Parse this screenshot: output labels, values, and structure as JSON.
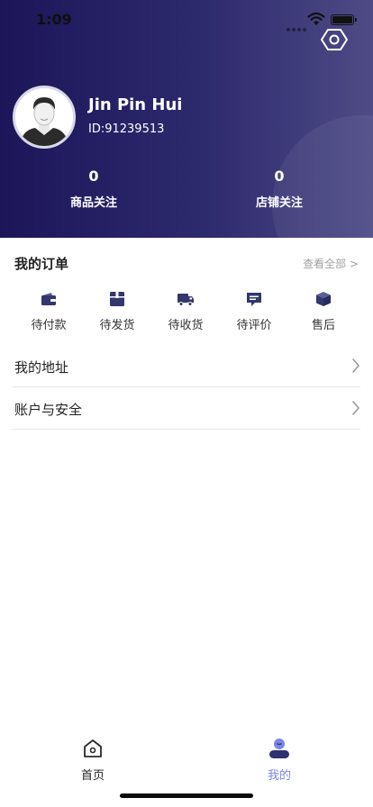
{
  "status_bar": {
    "time": "1:09"
  },
  "profile": {
    "name": "Jin Pin Hui",
    "id": "ID:91239513",
    "stats": [
      {
        "count": "0",
        "label": "商品关注"
      },
      {
        "count": "0",
        "label": "店铺关注"
      }
    ]
  },
  "orders": {
    "title": "我的订单",
    "view_all": "查看全部 >",
    "items": [
      {
        "label": "待付款",
        "icon": "wallet-icon"
      },
      {
        "label": "待发货",
        "icon": "package-box-icon"
      },
      {
        "label": "待收货",
        "icon": "delivery-truck-icon"
      },
      {
        "label": "待评价",
        "icon": "review-message-icon"
      },
      {
        "label": "售后",
        "icon": "after-sales-box-icon"
      }
    ]
  },
  "menu": [
    {
      "label": "我的地址"
    },
    {
      "label": "账户与安全"
    }
  ],
  "tabbar": {
    "items": [
      {
        "label": "首页",
        "icon": "home-icon"
      },
      {
        "label": "我的",
        "icon": "profile-icon"
      }
    ],
    "active_color": "#7c84e8",
    "inactive_color": "#222222"
  },
  "colors": {
    "header_start": "#1c1659",
    "header_end": "#4e4b86",
    "icon_dark": "#33376e"
  }
}
